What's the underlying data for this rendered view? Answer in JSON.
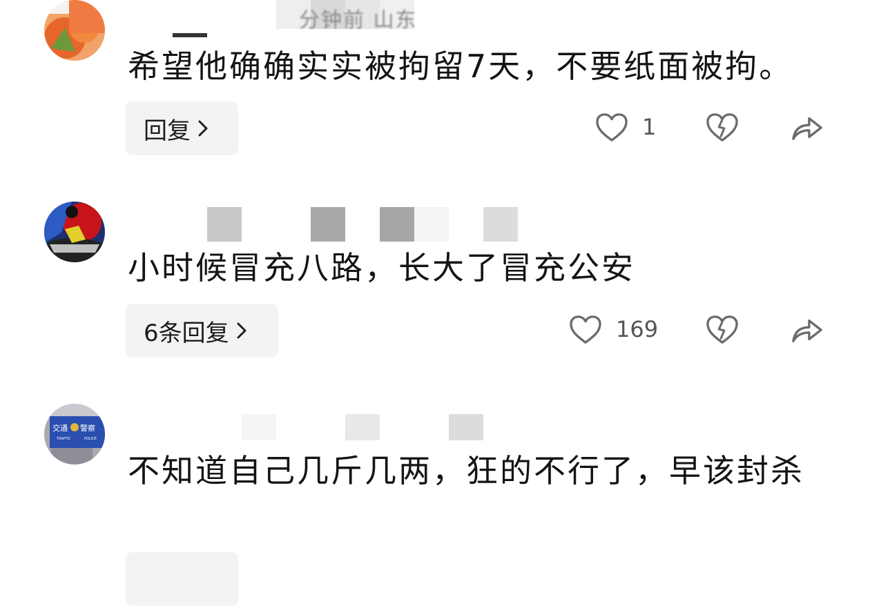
{
  "comments": [
    {
      "meta_text": "分钟前  山东",
      "content": "希望他确确实实被拘留7天，不要纸面被拘。",
      "reply_label": "回复",
      "like_count": "1"
    },
    {
      "meta_text": "",
      "content": "小时候冒充八路，长大了冒充公安",
      "reply_label": "6条回复",
      "like_count": "169"
    },
    {
      "meta_text": "",
      "content": "不知道自己几斤几两，狂的不行了，早该封杀",
      "reply_label": "",
      "like_count": ""
    }
  ],
  "avatar3_text": {
    "line1": "交通",
    "line2": "警察",
    "line3": "TRAFFIC",
    "line4": "POLICE"
  },
  "colors": {
    "reply_bg": "#f3f3f3",
    "icon": "#6b6b6b",
    "text": "#141414",
    "meta": "#8a8a8a"
  },
  "icons": [
    "heart-icon",
    "broken-heart-icon",
    "share-icon",
    "chevron-right-icon"
  ]
}
